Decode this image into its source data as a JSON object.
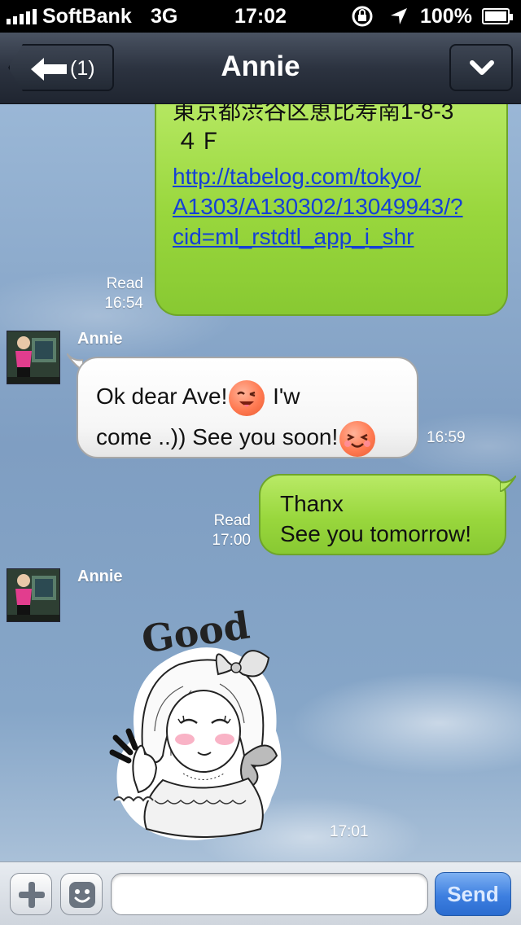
{
  "status_bar": {
    "carrier": "SoftBank",
    "network": "3G",
    "time": "17:02",
    "battery": "100%"
  },
  "nav": {
    "back_count": "(1)",
    "title": "Annie"
  },
  "messages": {
    "m1": {
      "line1": "東京都渋谷区恵比寿南1-8-3",
      "line2": "４Ｆ",
      "link": "http://tabelog.com/tokyo/A1303/A130302/13049943/?cid=ml_rstdtl_app_i_shr",
      "link_line1": "http://tabelog.com/tokyo/",
      "link_line2": "A1303/A130302/13049943/?",
      "link_line3": "cid=ml_rstdtl_app_i_shr",
      "read": "Read",
      "time": "16:54"
    },
    "m2": {
      "sender": "Annie",
      "text_a": "Ok dear Ave!",
      "text_b": "I'w",
      "text_c": "come ..)) See you soon!",
      "time": "16:59"
    },
    "m3": {
      "line1": "Thanx",
      "line2": "See you tomorrow!",
      "read": "Read",
      "time": "17:00"
    },
    "m4": {
      "sender": "Annie",
      "sticker_text": "Good",
      "time": "17:01"
    }
  },
  "input_bar": {
    "placeholder": "",
    "send_label": "Send"
  },
  "colors": {
    "bubble_green": "#99d73d",
    "link_blue": "#1540d6",
    "send_blue": "#3d7fe0",
    "nav_dark": "#2c3340"
  }
}
